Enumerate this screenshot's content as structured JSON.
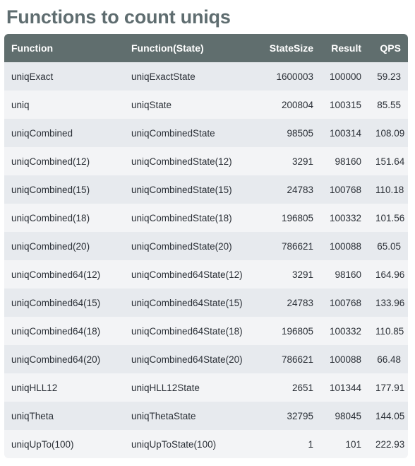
{
  "page": {
    "title": "Functions to count uniqs",
    "accent_header_bg": "#606e6e",
    "title_color": "#5f6d70",
    "row_odd_bg": "#e7eaee",
    "row_even_bg": "#f3f4f6",
    "text_color": "#2a2f36"
  },
  "table": {
    "columns": [
      {
        "key": "function",
        "label": "Function",
        "align": "left"
      },
      {
        "key": "function_state",
        "label": "Function(State)",
        "align": "left"
      },
      {
        "key": "state_size",
        "label": "StateSize",
        "align": "right"
      },
      {
        "key": "result",
        "label": "Result",
        "align": "right"
      },
      {
        "key": "qps",
        "label": "QPS",
        "align": "right"
      }
    ],
    "rows": [
      {
        "function": "uniqExact",
        "function_state": "uniqExactState",
        "state_size": "1600003",
        "result": "100000",
        "qps": "59.23"
      },
      {
        "function": "uniq",
        "function_state": "uniqState",
        "state_size": "200804",
        "result": "100315",
        "qps": "85.55"
      },
      {
        "function": "uniqCombined",
        "function_state": "uniqCombinedState",
        "state_size": "98505",
        "result": "100314",
        "qps": "108.09"
      },
      {
        "function": "uniqCombined(12)",
        "function_state": "uniqCombinedState(12)",
        "state_size": "3291",
        "result": "98160",
        "qps": "151.64"
      },
      {
        "function": "uniqCombined(15)",
        "function_state": "uniqCombinedState(15)",
        "state_size": "24783",
        "result": "100768",
        "qps": "110.18"
      },
      {
        "function": "uniqCombined(18)",
        "function_state": "uniqCombinedState(18)",
        "state_size": "196805",
        "result": "100332",
        "qps": "101.56"
      },
      {
        "function": "uniqCombined(20)",
        "function_state": "uniqCombinedState(20)",
        "state_size": "786621",
        "result": "100088",
        "qps": "65.05"
      },
      {
        "function": "uniqCombined64(12)",
        "function_state": "uniqCombined64State(12)",
        "state_size": "3291",
        "result": "98160",
        "qps": "164.96"
      },
      {
        "function": "uniqCombined64(15)",
        "function_state": "uniqCombined64State(15)",
        "state_size": "24783",
        "result": "100768",
        "qps": "133.96"
      },
      {
        "function": "uniqCombined64(18)",
        "function_state": "uniqCombined64State(18)",
        "state_size": "196805",
        "result": "100332",
        "qps": "110.85"
      },
      {
        "function": "uniqCombined64(20)",
        "function_state": "uniqCombined64State(20)",
        "state_size": "786621",
        "result": "100088",
        "qps": "66.48"
      },
      {
        "function": "uniqHLL12",
        "function_state": "uniqHLL12State",
        "state_size": "2651",
        "result": "101344",
        "qps": "177.91"
      },
      {
        "function": "uniqTheta",
        "function_state": "uniqThetaState",
        "state_size": "32795",
        "result": "98045",
        "qps": "144.05"
      },
      {
        "function": "uniqUpTo(100)",
        "function_state": "uniqUpToState(100)",
        "state_size": "1",
        "result": "101",
        "qps": "222.93"
      }
    ]
  }
}
